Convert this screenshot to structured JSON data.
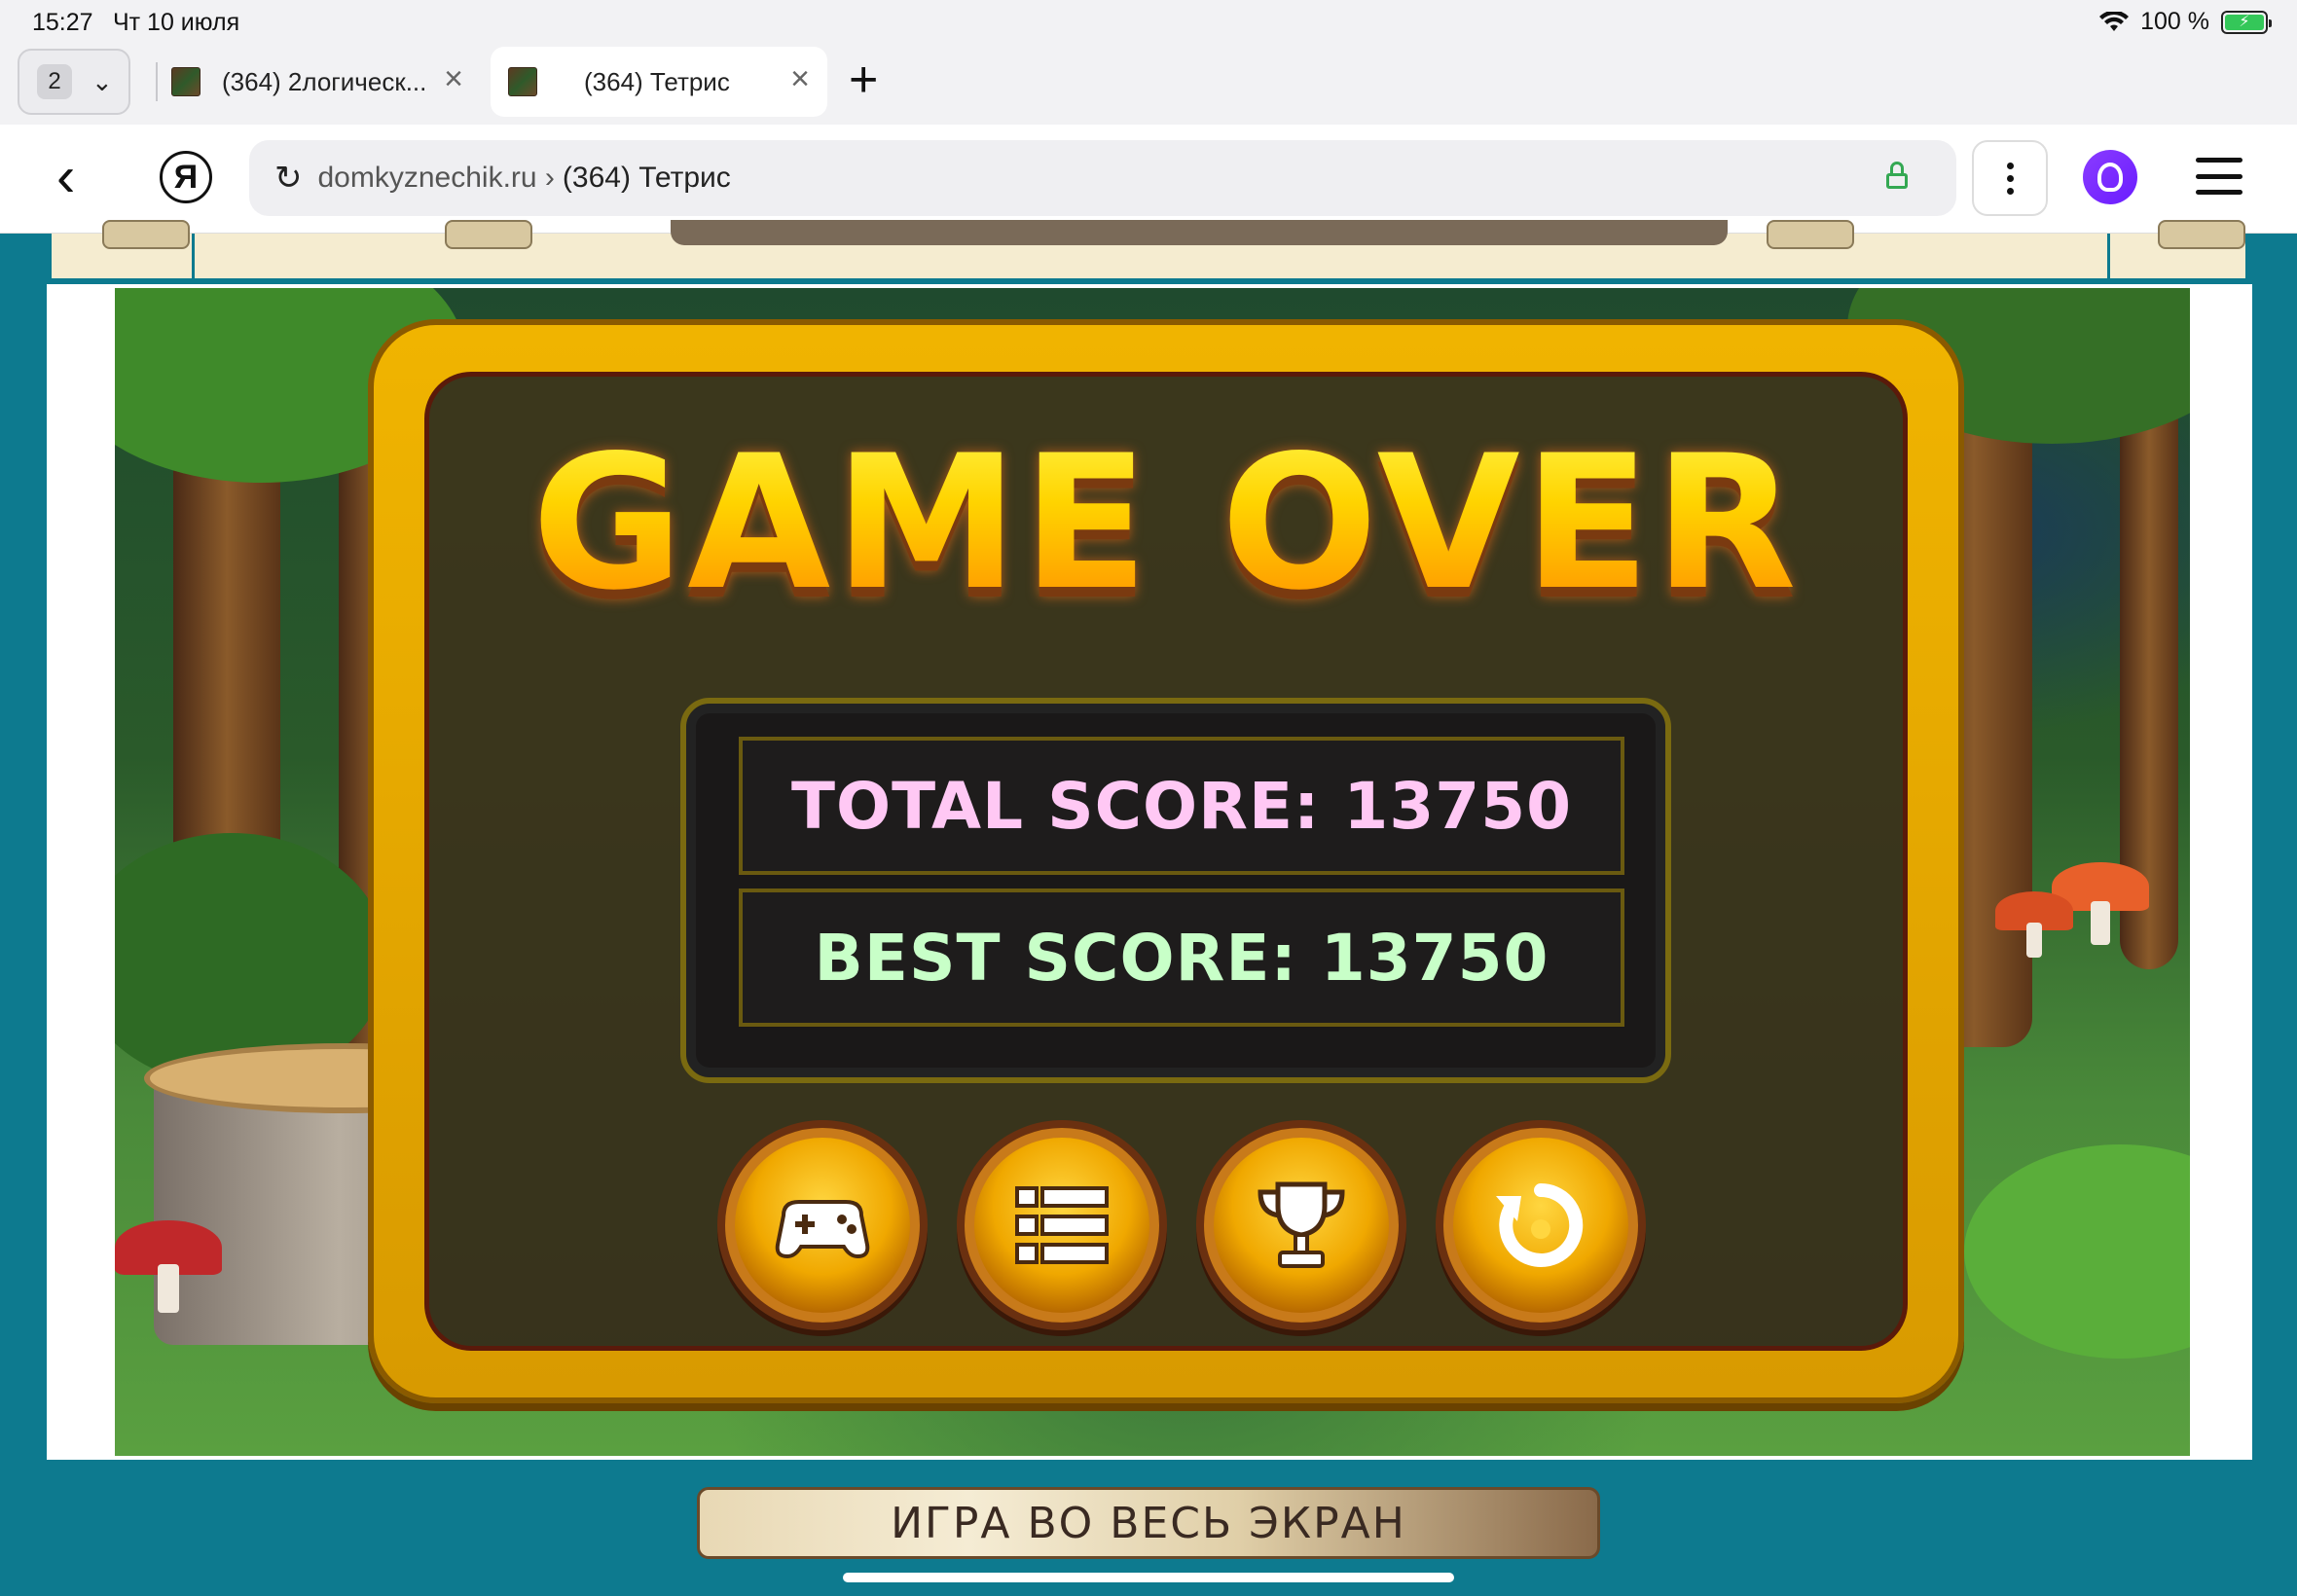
{
  "status_bar": {
    "time": "15:27",
    "date": "Чт 10 июля",
    "battery_percent": "100 %"
  },
  "tabs": {
    "count": "2",
    "items": [
      {
        "title": "(364) 2логическ...",
        "active": false
      },
      {
        "title": "(364) Тетрис",
        "active": true
      }
    ]
  },
  "address_bar": {
    "domain": "domkyznechik.ru ›",
    "page_title": "(364) Тетрис"
  },
  "game": {
    "heading": "GAME OVER",
    "total_score": "TOTAL SCORE: 13750",
    "best_score": "BEST SCORE: 13750",
    "buttons": [
      "gamepad-icon",
      "list-icon",
      "trophy-icon",
      "replay-icon"
    ]
  },
  "page": {
    "fullscreen_label": "ИГРА ВО ВЕСЬ ЭКРАН"
  },
  "colors": {
    "page_bg": "#0d7a8f",
    "panel_gold": "#f0b400",
    "total_score": "#ffc8f4",
    "best_score": "#c8ffc8",
    "battery_green": "#34c759"
  }
}
